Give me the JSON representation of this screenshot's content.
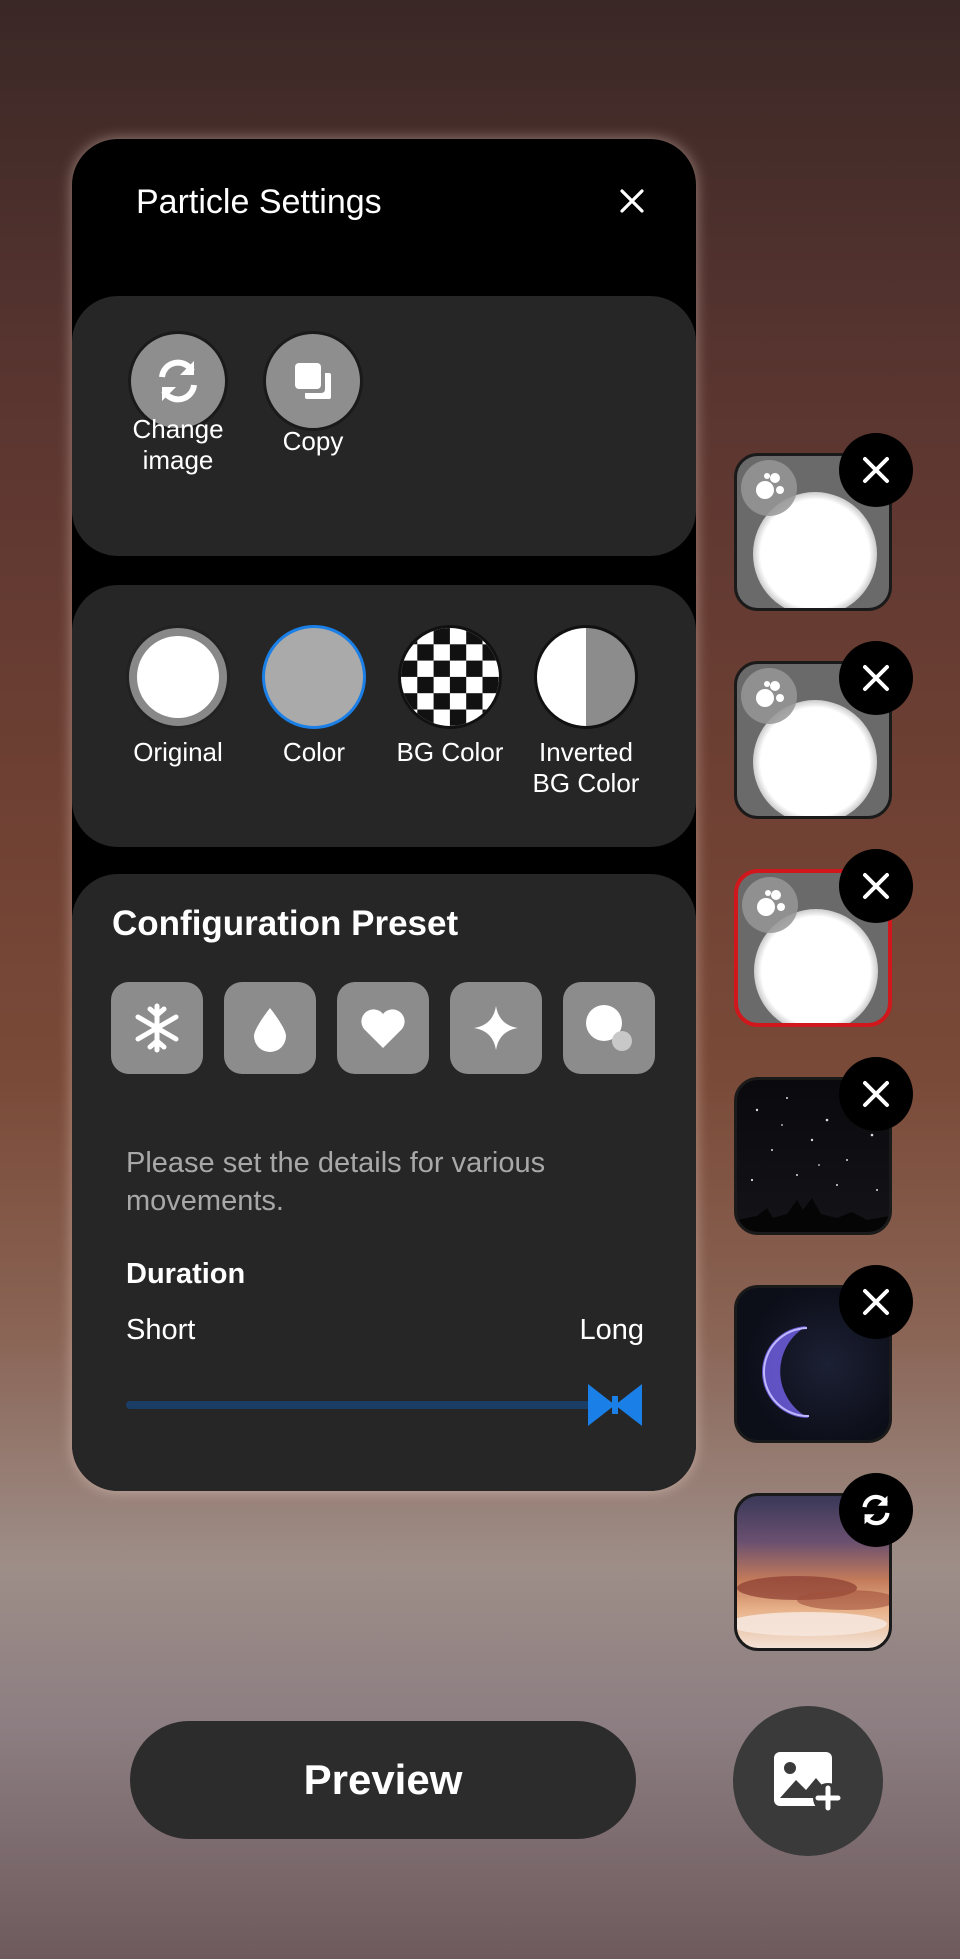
{
  "panel": {
    "title": "Particle Settings",
    "actions": [
      {
        "label": "Change\nimage",
        "icon": "refresh-icon"
      },
      {
        "label": "Copy",
        "icon": "copy-icon"
      }
    ],
    "styles": [
      {
        "label": "Original",
        "icon": "original-swatch"
      },
      {
        "label": "Color",
        "icon": "color-swatch",
        "selected": true
      },
      {
        "label": "BG Color",
        "icon": "checkerboard-swatch"
      },
      {
        "label": "Inverted\nBG Color",
        "icon": "inverted-swatch"
      }
    ],
    "config": {
      "title": "Configuration Preset",
      "presets": [
        "snowflake-icon",
        "droplet-icon",
        "heart-icon",
        "sparkle-icon",
        "bubble-icon"
      ],
      "description": "Please set the details for various movements.",
      "duration_label": "Duration",
      "short_label": "Short",
      "long_label": "Long",
      "duration_value": 1.0
    }
  },
  "thumbnails": [
    {
      "type": "particle",
      "selected": false,
      "badge": "close-icon"
    },
    {
      "type": "particle",
      "selected": false,
      "badge": "close-icon"
    },
    {
      "type": "particle",
      "selected": true,
      "badge": "close-icon"
    },
    {
      "type": "night-sky",
      "selected": false,
      "badge": "close-icon"
    },
    {
      "type": "crescent",
      "selected": false,
      "badge": "close-icon"
    },
    {
      "type": "sunset",
      "selected": false,
      "badge": "refresh-icon"
    }
  ],
  "footer": {
    "preview_label": "Preview",
    "add_image_icon": "add-image-icon"
  },
  "colors": {
    "accent": "#1a7fe6",
    "selected_border": "#d0181c",
    "card_bg": "#262626"
  }
}
